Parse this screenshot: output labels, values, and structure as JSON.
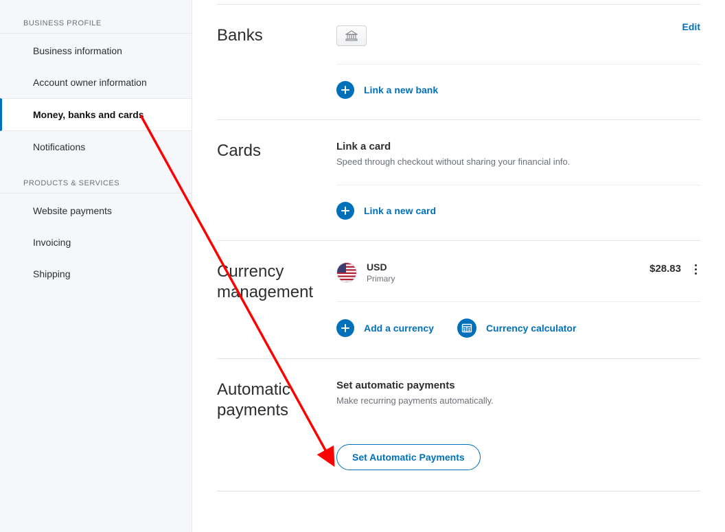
{
  "sidebar": {
    "section1_label": "BUSINESS PROFILE",
    "section2_label": "PRODUCTS & SERVICES",
    "items": [
      {
        "label": "Business information"
      },
      {
        "label": "Account owner information"
      },
      {
        "label": "Money, banks and cards"
      },
      {
        "label": "Notifications"
      }
    ],
    "items2": [
      {
        "label": "Website payments"
      },
      {
        "label": "Invoicing"
      },
      {
        "label": "Shipping"
      }
    ]
  },
  "banks": {
    "title": "Banks",
    "edit": "Edit",
    "link_action": "Link a new bank"
  },
  "cards": {
    "title": "Cards",
    "heading": "Link a card",
    "desc": "Speed through checkout without sharing your financial info.",
    "link_action": "Link a new card"
  },
  "currency": {
    "title": "Currency management",
    "code": "USD",
    "status": "Primary",
    "balance": "$28.83",
    "add_action": "Add a currency",
    "calc_action": "Currency calculator"
  },
  "automatic": {
    "title": "Automatic payments",
    "heading": "Set automatic payments",
    "desc": "Make recurring payments automatically.",
    "button": "Set Automatic Payments"
  }
}
